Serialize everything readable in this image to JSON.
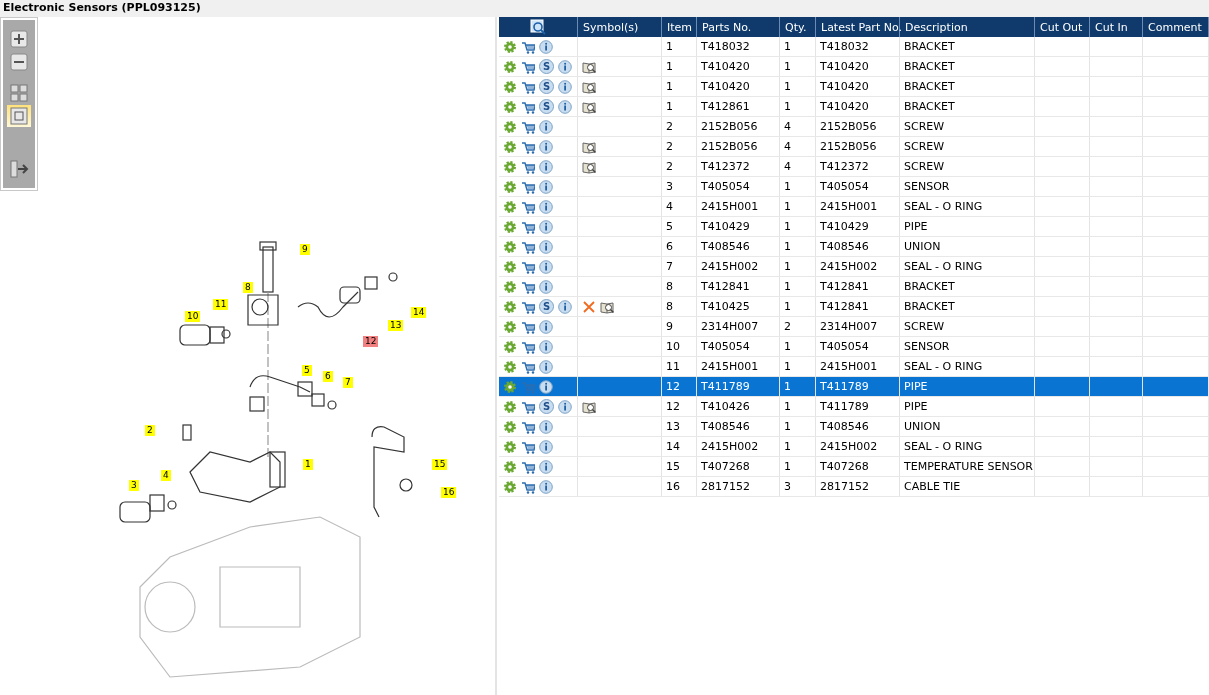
{
  "window": {
    "title": "Electronic Sensors (PPL093125)"
  },
  "toolbar": [
    {
      "kind": "zoom-in",
      "selected": false
    },
    {
      "kind": "zoom-out",
      "selected": false
    },
    {
      "kind": "grid",
      "selected": false
    },
    {
      "kind": "single",
      "selected": true
    },
    {
      "kind": "export",
      "selected": false
    }
  ],
  "callouts": [
    {
      "label": "9",
      "highlighted": false
    },
    {
      "label": "8",
      "highlighted": false
    },
    {
      "label": "11",
      "highlighted": false
    },
    {
      "label": "10",
      "highlighted": false
    },
    {
      "label": "14",
      "highlighted": false
    },
    {
      "label": "13",
      "highlighted": false
    },
    {
      "label": "12",
      "highlighted": true
    },
    {
      "label": "5",
      "highlighted": false
    },
    {
      "label": "6",
      "highlighted": false
    },
    {
      "label": "7",
      "highlighted": false
    },
    {
      "label": "2",
      "highlighted": false
    },
    {
      "label": "1",
      "highlighted": false
    },
    {
      "label": "15",
      "highlighted": false
    },
    {
      "label": "16",
      "highlighted": false
    },
    {
      "label": "4",
      "highlighted": false
    },
    {
      "label": "3",
      "highlighted": false
    }
  ],
  "table": {
    "symbol_column": "Symbol(s)",
    "columns": [
      "Item",
      "Parts No.",
      "Qty.",
      "Latest Part No.",
      "Description",
      "Cut Out",
      "Cut In",
      "Comment"
    ],
    "rows": [
      {
        "cross": false,
        "book": false,
        "selected": false,
        "cells": [
          "1",
          "T418032",
          "1",
          "T418032",
          "BRACKET"
        ]
      },
      {
        "badge": "S",
        "cross": false,
        "book": true,
        "selected": false,
        "cells": [
          "1",
          "T410420",
          "1",
          "T410420",
          "BRACKET"
        ]
      },
      {
        "badge": "S",
        "cross": false,
        "book": true,
        "selected": false,
        "cells": [
          "1",
          "T410420",
          "1",
          "T410420",
          "BRACKET"
        ]
      },
      {
        "badge": "S",
        "cross": false,
        "book": true,
        "selected": false,
        "cells": [
          "1",
          "T412861",
          "1",
          "T410420",
          "BRACKET"
        ]
      },
      {
        "cross": false,
        "book": false,
        "selected": false,
        "cells": [
          "2",
          "2152B056",
          "4",
          "2152B056",
          "SCREW"
        ]
      },
      {
        "cross": false,
        "book": true,
        "selected": false,
        "cells": [
          "2",
          "2152B056",
          "4",
          "2152B056",
          "SCREW"
        ]
      },
      {
        "cross": false,
        "book": true,
        "selected": false,
        "cells": [
          "2",
          "T412372",
          "4",
          "T412372",
          "SCREW"
        ]
      },
      {
        "cross": false,
        "book": false,
        "selected": false,
        "cells": [
          "3",
          "T405054",
          "1",
          "T405054",
          "SENSOR"
        ]
      },
      {
        "cross": false,
        "book": false,
        "selected": false,
        "cells": [
          "4",
          "2415H001",
          "1",
          "2415H001",
          "SEAL - O RING"
        ]
      },
      {
        "cross": false,
        "book": false,
        "selected": false,
        "cells": [
          "5",
          "T410429",
          "1",
          "T410429",
          "PIPE"
        ]
      },
      {
        "cross": false,
        "book": false,
        "selected": false,
        "cells": [
          "6",
          "T408546",
          "1",
          "T408546",
          "UNION"
        ]
      },
      {
        "cross": false,
        "book": false,
        "selected": false,
        "cells": [
          "7",
          "2415H002",
          "1",
          "2415H002",
          "SEAL - O RING"
        ]
      },
      {
        "cross": false,
        "book": false,
        "selected": false,
        "cells": [
          "8",
          "T412841",
          "1",
          "T412841",
          "BRACKET"
        ]
      },
      {
        "badge": "S",
        "cross": true,
        "book": true,
        "selected": false,
        "cells": [
          "8",
          "T410425",
          "1",
          "T412841",
          "BRACKET"
        ]
      },
      {
        "cross": false,
        "book": false,
        "selected": false,
        "cells": [
          "9",
          "2314H007",
          "2",
          "2314H007",
          "SCREW"
        ]
      },
      {
        "cross": false,
        "book": false,
        "selected": false,
        "cells": [
          "10",
          "T405054",
          "1",
          "T405054",
          "SENSOR"
        ]
      },
      {
        "cross": false,
        "book": false,
        "selected": false,
        "cells": [
          "11",
          "2415H001",
          "1",
          "2415H001",
          "SEAL - O RING"
        ]
      },
      {
        "cross": false,
        "book": false,
        "selected": true,
        "cells": [
          "12",
          "T411789",
          "1",
          "T411789",
          "PIPE"
        ]
      },
      {
        "badge": "S",
        "cross": false,
        "book": true,
        "selected": false,
        "cells": [
          "12",
          "T410426",
          "1",
          "T411789",
          "PIPE"
        ]
      },
      {
        "cross": false,
        "book": false,
        "selected": false,
        "cells": [
          "13",
          "T408546",
          "1",
          "T408546",
          "UNION"
        ]
      },
      {
        "cross": false,
        "book": false,
        "selected": false,
        "cells": [
          "14",
          "2415H002",
          "1",
          "2415H002",
          "SEAL - O RING"
        ]
      },
      {
        "cross": false,
        "book": false,
        "selected": false,
        "cells": [
          "15",
          "T407268",
          "1",
          "T407268",
          "TEMPERATURE SENSOR"
        ]
      },
      {
        "cross": false,
        "book": false,
        "selected": false,
        "cells": [
          "16",
          "2817152",
          "3",
          "2817152",
          "CABLE TIE"
        ]
      }
    ]
  }
}
